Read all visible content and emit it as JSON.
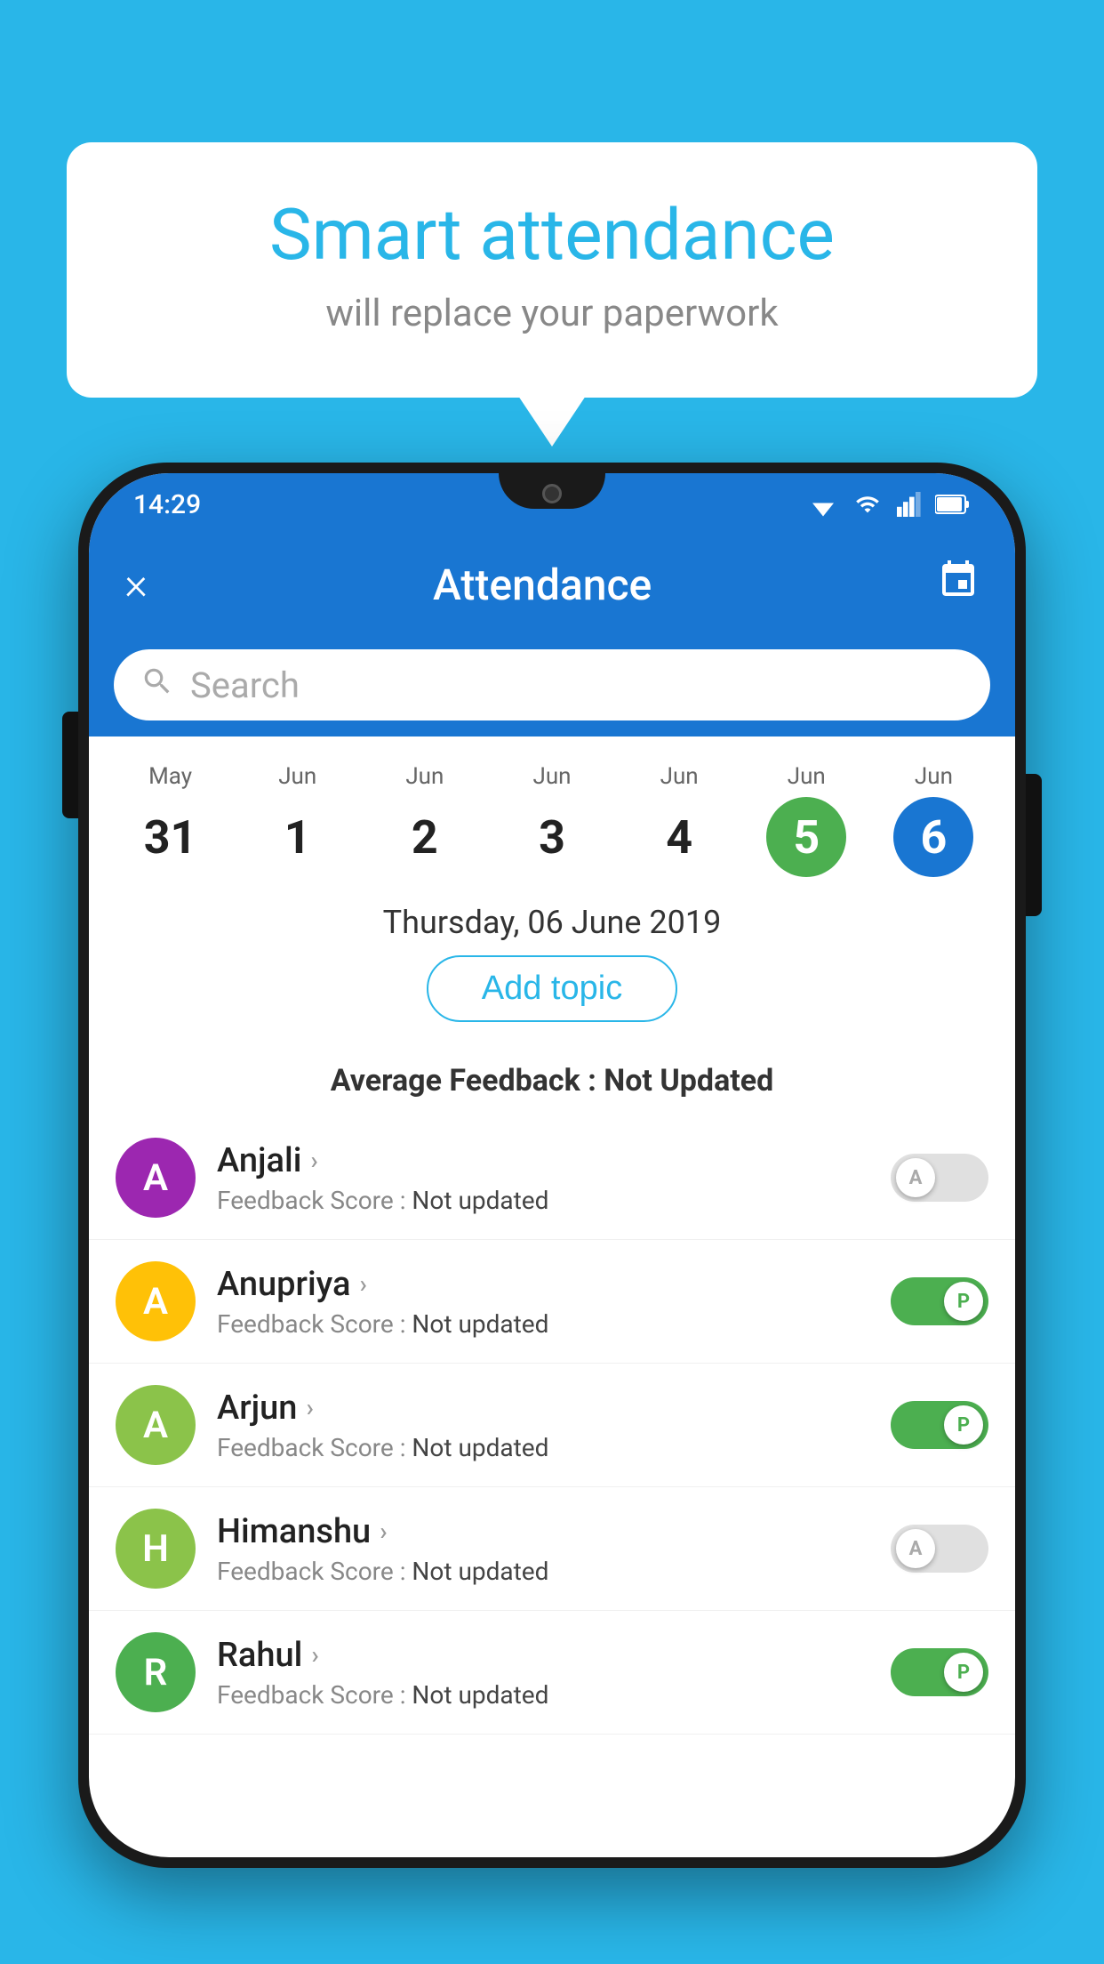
{
  "background_color": "#29B6E8",
  "bubble": {
    "title": "Smart attendance",
    "subtitle": "will replace your paperwork"
  },
  "status_bar": {
    "time": "14:29",
    "wifi_icon": "wifi-icon",
    "signal_icon": "signal-icon",
    "battery_icon": "battery-icon"
  },
  "app_bar": {
    "close_label": "×",
    "title": "Attendance",
    "calendar_icon": "calendar-icon"
  },
  "search": {
    "placeholder": "Search"
  },
  "calendar": {
    "days": [
      {
        "month": "May",
        "date": "31",
        "state": "normal"
      },
      {
        "month": "Jun",
        "date": "1",
        "state": "normal"
      },
      {
        "month": "Jun",
        "date": "2",
        "state": "normal"
      },
      {
        "month": "Jun",
        "date": "3",
        "state": "normal"
      },
      {
        "month": "Jun",
        "date": "4",
        "state": "normal"
      },
      {
        "month": "Jun",
        "date": "5",
        "state": "today"
      },
      {
        "month": "Jun",
        "date": "6",
        "state": "selected"
      }
    ]
  },
  "selected_date": "Thursday, 06 June 2019",
  "add_topic_label": "Add topic",
  "average_feedback_label": "Average Feedback :",
  "average_feedback_value": "Not Updated",
  "students": [
    {
      "name": "Anjali",
      "avatar_letter": "A",
      "avatar_color": "#9C27B0",
      "feedback_label": "Feedback Score :",
      "feedback_value": "Not updated",
      "toggle_state": "off",
      "toggle_letter": "A"
    },
    {
      "name": "Anupriya",
      "avatar_letter": "A",
      "avatar_color": "#FFC107",
      "feedback_label": "Feedback Score :",
      "feedback_value": "Not updated",
      "toggle_state": "on",
      "toggle_letter": "P"
    },
    {
      "name": "Arjun",
      "avatar_letter": "A",
      "avatar_color": "#8BC34A",
      "feedback_label": "Feedback Score :",
      "feedback_value": "Not updated",
      "toggle_state": "on",
      "toggle_letter": "P"
    },
    {
      "name": "Himanshu",
      "avatar_letter": "H",
      "avatar_color": "#8BC34A",
      "feedback_label": "Feedback Score :",
      "feedback_value": "Not updated",
      "toggle_state": "off",
      "toggle_letter": "A"
    },
    {
      "name": "Rahul",
      "avatar_letter": "R",
      "avatar_color": "#4CAF50",
      "feedback_label": "Feedback Score :",
      "feedback_value": "Not updated",
      "toggle_state": "on",
      "toggle_letter": "P"
    }
  ]
}
